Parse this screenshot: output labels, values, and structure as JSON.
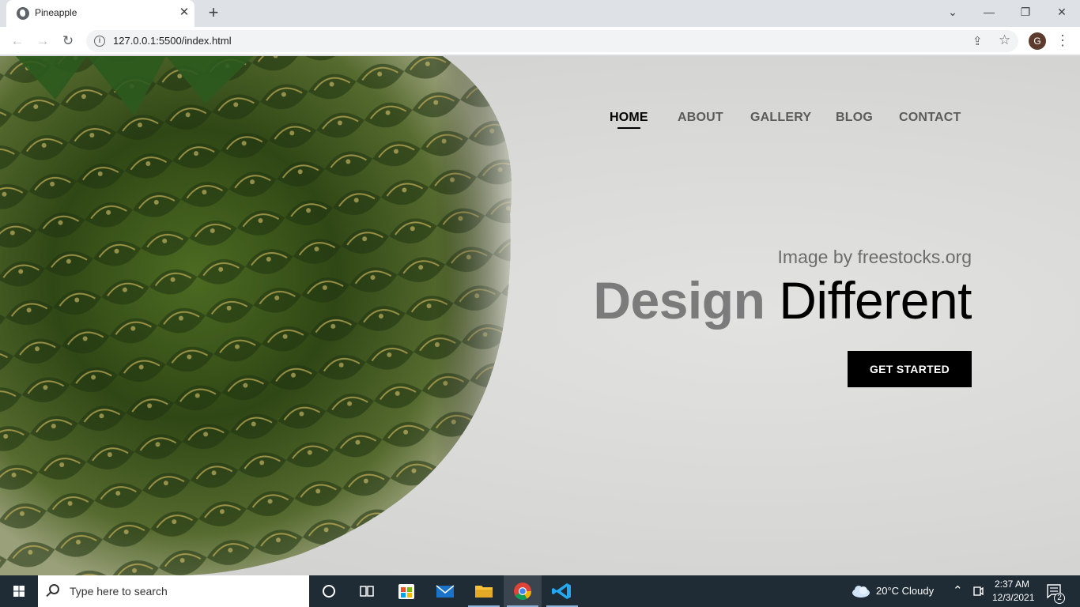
{
  "browser": {
    "tab_title": "Pineapple",
    "url": "127.0.0.1:5500/index.html",
    "profile_initial": "G"
  },
  "site": {
    "nav": [
      "HOME",
      "ABOUT",
      "GALLERY",
      "BLOG",
      "CONTACT"
    ],
    "active_nav": "HOME",
    "caption": "Image by freestocks.org",
    "headline_strong": "Design",
    "headline_rest": "Different",
    "cta_label": "GET STARTED"
  },
  "taskbar": {
    "search_placeholder": "Type here to search",
    "weather": "20°C  Cloudy",
    "time": "2:37 AM",
    "date": "12/3/2021",
    "notification_count": "2"
  },
  "colors": {
    "nav_inactive": "#5b5b5b",
    "headline_strong": "#7b7b7b",
    "cta_bg": "#000000",
    "taskbar_bg": "#1f2b35"
  }
}
